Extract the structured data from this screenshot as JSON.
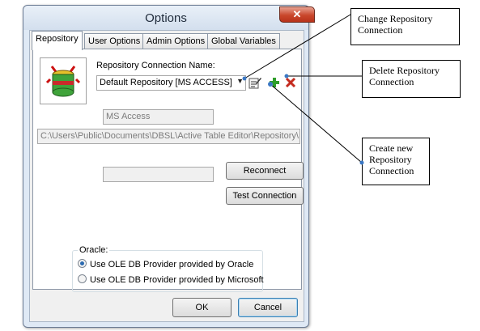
{
  "window": {
    "title": "Options",
    "close_glyph": "✕"
  },
  "tabs": [
    {
      "label": "Repository",
      "active": true
    },
    {
      "label": "User Options"
    },
    {
      "label": "Admin Options"
    },
    {
      "label": "Global Variables"
    }
  ],
  "repository": {
    "connection_label": "Repository Connection Name:",
    "connection_value": "Default Repository [MS ACCESS]",
    "type_value": "MS Access",
    "path_value": "C:\\Users\\Public\\Documents\\DBSL\\Active Table Editor\\Repository\\",
    "status_value": "",
    "reconnect_label": "Reconnect",
    "test_label": "Test Connection",
    "icons": [
      "edit-connection-icon",
      "add-connection-icon",
      "delete-connection-icon"
    ]
  },
  "oracle": {
    "legend": "Oracle:",
    "options": [
      {
        "label": "Use OLE DB Provider provided by Oracle",
        "checked": true
      },
      {
        "label": "Use OLE DB Provider provided by Microsoft",
        "checked": false
      }
    ]
  },
  "footer": {
    "ok_label": "OK",
    "cancel_label": "Cancel"
  },
  "callouts": {
    "change": "Change Repository\nConnection",
    "delete": "Delete Repository\nConnection",
    "create": "Create new\nRepository\nConnection"
  },
  "colors": {
    "add": "#2f9d2a",
    "delete": "#c42a1e",
    "accent": "#2b6ab0"
  }
}
